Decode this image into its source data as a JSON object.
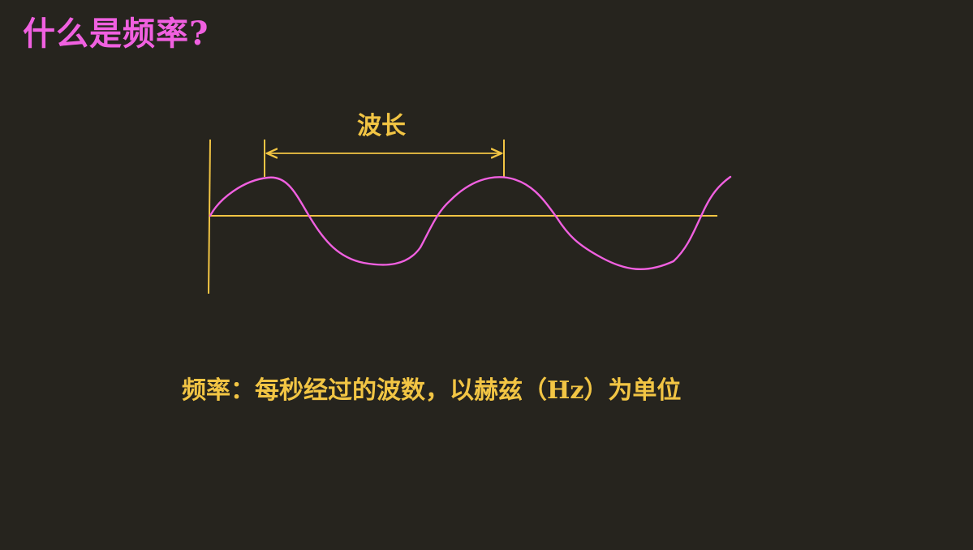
{
  "slide": {
    "title": "什么是频率?",
    "diagram": {
      "wavelength_label": "波长",
      "wave_color": "#f060e0",
      "axis_color": "#f2c544"
    },
    "caption": "频率：每秒经过的波数，以赫兹（Hz）为单位"
  }
}
